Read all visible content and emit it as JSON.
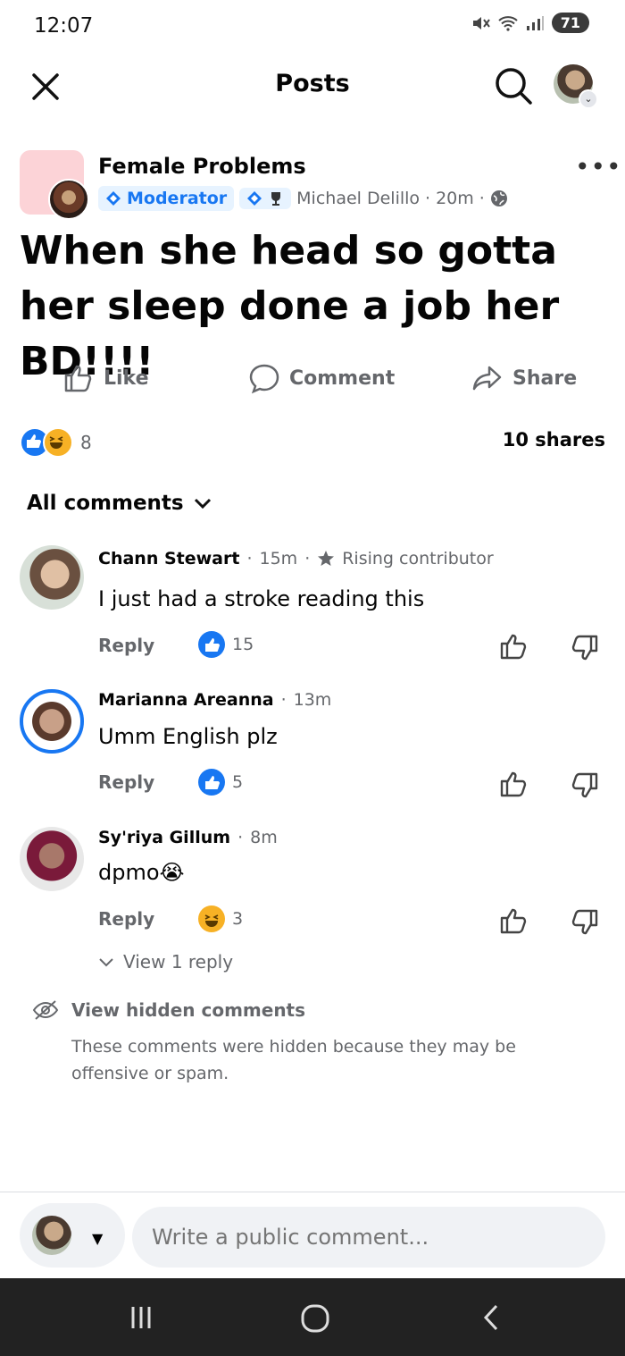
{
  "status": {
    "time": "12:07",
    "battery": "71"
  },
  "header": {
    "title": "Posts"
  },
  "post": {
    "group_name": "Female Problems",
    "badge": "Moderator",
    "author": "Michael Delillo",
    "time": "20m",
    "text": "When she head so gotta her sleep done a job her BD!!!!"
  },
  "actions": {
    "like": "Like",
    "comment": "Comment",
    "share": "Share"
  },
  "reactions": {
    "count": "8",
    "shares": "10 shares"
  },
  "comments_filter": "All comments",
  "comments": [
    {
      "name": "Chann Stewart",
      "time": "15m",
      "tag": "Rising contributor",
      "text": "I just had a stroke reading this",
      "reply": "Reply",
      "reaction_count": "15"
    },
    {
      "name": "Marianna Areanna",
      "time": "13m",
      "text": "Umm English plz",
      "reply": "Reply",
      "reaction_count": "5"
    },
    {
      "name": "Sy'riya Gillum",
      "time": "8m",
      "text": "dpmo😭",
      "reply": "Reply",
      "reaction_count": "3",
      "view_replies": "View 1 reply"
    }
  ],
  "hidden": {
    "title": "View hidden comments",
    "desc": "These comments were hidden because they may be offensive or spam."
  },
  "composer": {
    "placeholder": "Write a public comment..."
  },
  "colors": {
    "accent": "#1877f2",
    "haha": "#f7b125"
  }
}
